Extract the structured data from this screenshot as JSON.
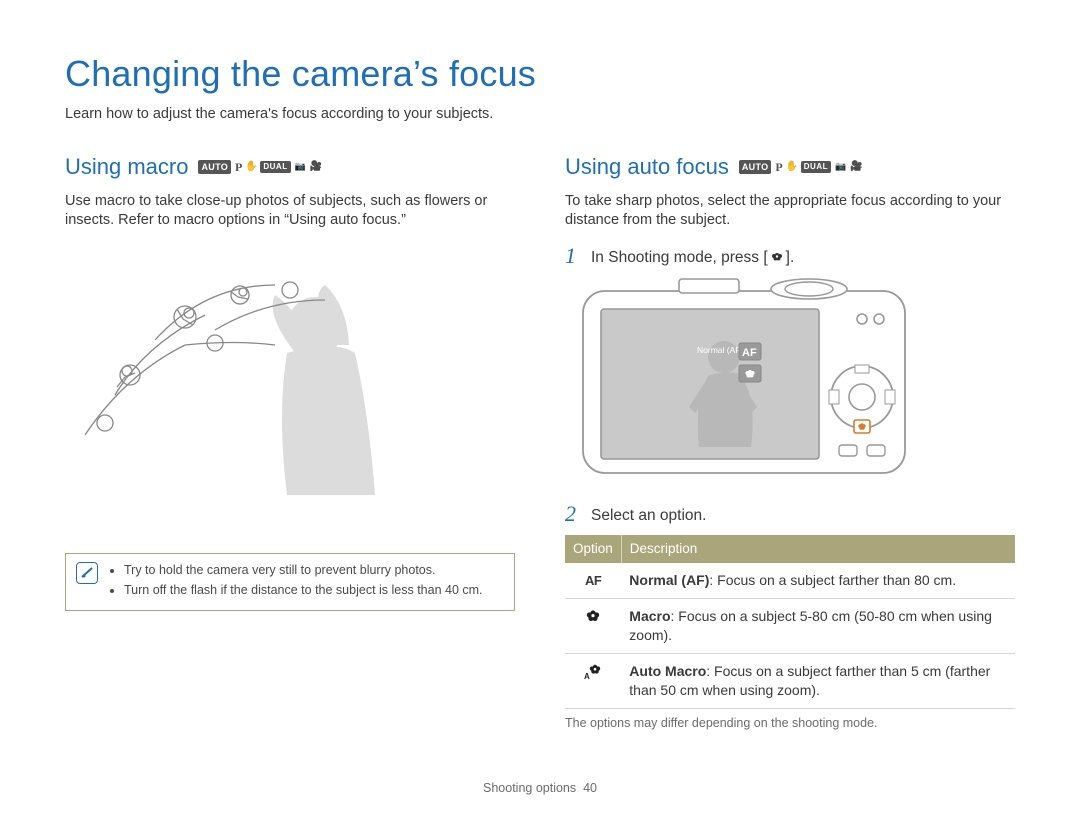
{
  "title": "Changing the camera’s focus",
  "intro": "Learn how to adjust the camera's focus according to your subjects.",
  "mode_badges": {
    "auto": "AUTO",
    "p": "P",
    "dual": "DUAL"
  },
  "left": {
    "heading": "Using macro",
    "para": "Use macro to take close-up photos of subjects, such as flowers or insects. Refer to macro options in “Using auto focus.”",
    "note_bullets": [
      "Try to hold the camera very still to prevent blurry photos.",
      "Turn off the flash if the distance to the subject is less than 40 cm."
    ]
  },
  "right": {
    "heading": "Using auto focus",
    "para": "To take sharp photos, select the appropriate focus according to your distance from the subject.",
    "step1_num": "1",
    "step1_pre": "In Shooting mode, press [",
    "step1_post": "].",
    "camera_screen_label": "Normal (AF)",
    "camera_screen_af": "AF",
    "step2_num": "2",
    "step2_text": "Select an option.",
    "table_headers": {
      "option": "Option",
      "desc": "Description"
    },
    "table_rows": [
      {
        "icon": "AF",
        "bold": "Normal (AF)",
        "rest": ": Focus on a subject farther than 80 cm."
      },
      {
        "icon": "flower",
        "bold": "Macro",
        "rest": ": Focus on a subject 5-80 cm (50-80 cm when using zoom)."
      },
      {
        "icon": "auto-flower",
        "bold": "Auto Macro",
        "rest": ": Focus on a subject farther than 5 cm (farther than 50 cm when using zoom)."
      }
    ],
    "footnote": "The options may differ depending on the shooting mode."
  },
  "footer": {
    "section": "Shooting options",
    "page": "40"
  }
}
